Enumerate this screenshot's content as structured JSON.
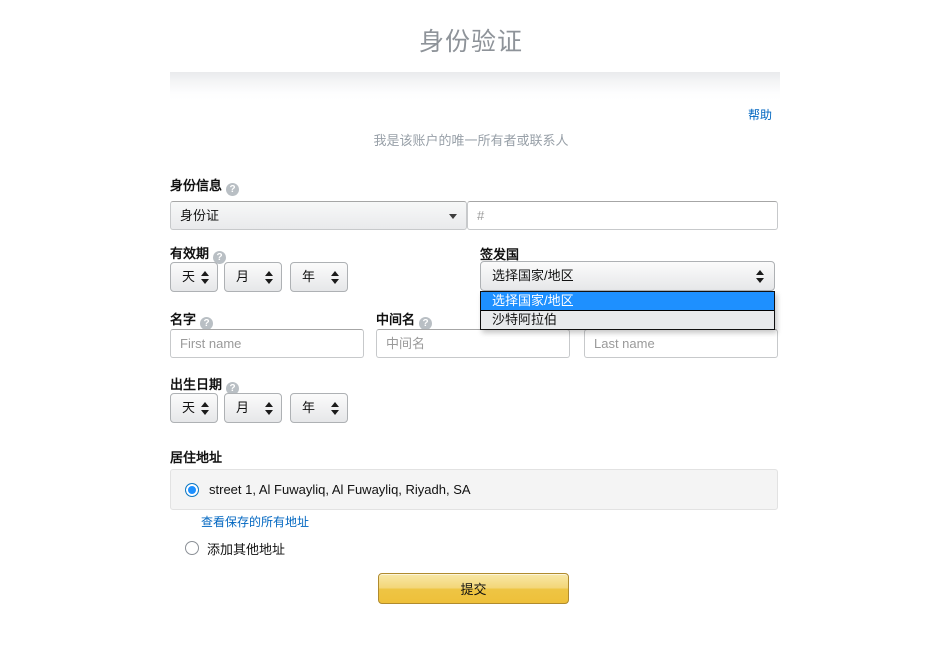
{
  "header": {
    "title": "身份验证",
    "help_label": "帮助",
    "subtitle": "我是该账户的唯一所有者或联系人"
  },
  "identity": {
    "label": "身份信息",
    "help_icon": "question-mark-icon",
    "type_value": "身份证",
    "number_placeholder": "#",
    "number_value": ""
  },
  "expiry": {
    "label": "有效期",
    "day_value": "天",
    "month_value": "月",
    "year_value": "年"
  },
  "issuing_country": {
    "label": "签发国",
    "value": "选择国家/地区",
    "options": [
      {
        "label": "选择国家/地区",
        "selected": true
      },
      {
        "label": "沙特阿拉伯",
        "selected": false
      }
    ],
    "expanded": true
  },
  "names": {
    "first_label": "名字",
    "first_placeholder": "First name",
    "first_value": "",
    "middle_label": "中间名",
    "middle_placeholder": "中间名",
    "middle_value": "",
    "last_placeholder": "Last name",
    "last_value": ""
  },
  "birth_date": {
    "label": "出生日期",
    "day_value": "天",
    "month_value": "月",
    "year_value": "年"
  },
  "address": {
    "label": "居住地址",
    "saved_address": "street 1, Al Fuwayliq, Al Fuwayliq, Riyadh, SA",
    "saved_selected": true,
    "view_all_link": "查看保存的所有地址",
    "other_label": "添加其他地址",
    "other_selected": false
  },
  "footer": {
    "submit_label": "提交"
  },
  "colors": {
    "link": "#0066c0",
    "title": "#8e9399",
    "subtitle": "#98a0a8",
    "highlight": "#1e90ff",
    "submit_start": "#f8e8a7",
    "submit_end": "#eec03a"
  }
}
